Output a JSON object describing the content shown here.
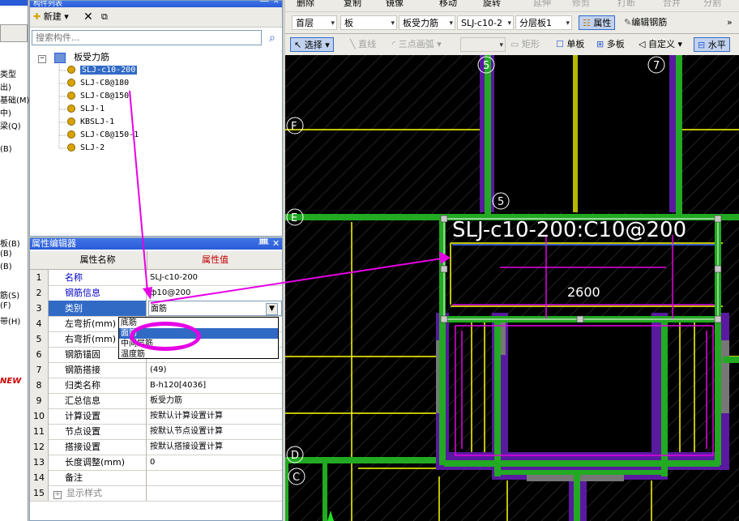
{
  "left_strip": {
    "labels": [
      "类型",
      "出)",
      "基础(M)",
      "中)",
      "梁(Q)",
      "(B)",
      "板(B)",
      "(B)",
      "(B)",
      "筋(S)",
      "(F)",
      "带(H)",
      "NEW"
    ]
  },
  "component_list": {
    "title": "构件列表",
    "new_label": "新建",
    "search_placeholder": "搜索构件...",
    "tree_root": "板受力筋",
    "items": [
      "SLJ-c10-200",
      "SLJ-C8@180",
      "SLJ-C8@150",
      "SLJ-1",
      "KBSLJ-1",
      "SLJ-C8@150-1",
      "SLJ-2"
    ],
    "selected_index": 0
  },
  "property_editor": {
    "title": "属性编辑器",
    "col_name": "属性名称",
    "col_value": "属性值",
    "rows": [
      {
        "n": "1",
        "name": "名称",
        "value": "SLJ-c10-200"
      },
      {
        "n": "2",
        "name": "钢筋信息",
        "value": "ф10@200"
      },
      {
        "n": "3",
        "name": "类别",
        "value": "面筋"
      },
      {
        "n": "4",
        "name": "左弯折(mm)",
        "value": ""
      },
      {
        "n": "5",
        "name": "右弯折(mm)",
        "value": ""
      },
      {
        "n": "6",
        "name": "钢筋锚固",
        "value": ""
      },
      {
        "n": "7",
        "name": "钢筋搭接",
        "value": "(49)"
      },
      {
        "n": "8",
        "name": "归类名称",
        "value": "B-h120[4036]"
      },
      {
        "n": "9",
        "name": "汇总信息",
        "value": "板受力筋"
      },
      {
        "n": "10",
        "name": "计算设置",
        "value": "按默认计算设置计算"
      },
      {
        "n": "11",
        "name": "节点设置",
        "value": "按默认节点设置计算"
      },
      {
        "n": "12",
        "name": "搭接设置",
        "value": "按默认搭接设置计算"
      },
      {
        "n": "13",
        "name": "长度调整(mm)",
        "value": "0"
      },
      {
        "n": "14",
        "name": "备注",
        "value": ""
      },
      {
        "n": "15",
        "name": "显示样式",
        "value": ""
      }
    ],
    "dropdown_options": [
      "底筋",
      "面筋",
      "中间层筋",
      "温度筋"
    ],
    "dropdown_selected": "面筋"
  },
  "toolbar_top": {
    "items": [
      "删除",
      "复制",
      "镜像",
      "移动",
      "旋转",
      "延伸",
      "修剪",
      "打断",
      "合并",
      "分割"
    ]
  },
  "toolbar_filter": {
    "floor": "首层",
    "category": "板",
    "type": "板受力筋",
    "component": "SLJ-c10-2",
    "layer": "分层板1",
    "attr_label": "属性",
    "edit_rebar_label": "编辑钢筋"
  },
  "toolbar_draw": {
    "select_label": "选择",
    "line_label": "直线",
    "arc_label": "三点画弧",
    "rect_label": "矩形",
    "single_label": "单板",
    "multi_label": "多板",
    "custom_label": "自定义",
    "horizontal_label": "水平"
  },
  "canvas": {
    "axis_labels": [
      "5",
      "7",
      "F",
      "5",
      "E",
      "D",
      "C"
    ],
    "rebar_label": "SLJ-c10-200:C10@200",
    "dimension": "2600"
  },
  "colors": {
    "accent": "#e600e6",
    "beam": "#22aa22",
    "wall": "#5a1aa0",
    "rebar": "#ffff00"
  }
}
